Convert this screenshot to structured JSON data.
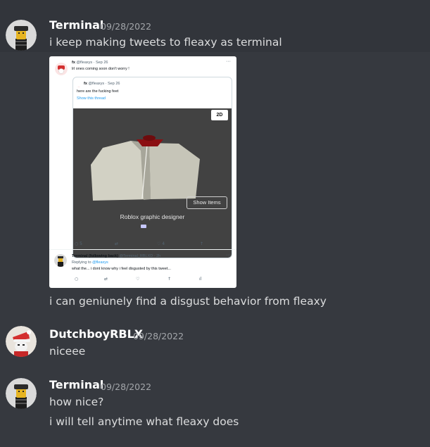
{
  "messages": [
    {
      "username": "Terminal",
      "timestamp": "09/28/2022",
      "avatar": "terminal-avatar",
      "lines": [
        "i keep making tweets to fleaxy as terminal"
      ],
      "after_attachment": "i can geniunely find a disgust behavior from fleaxy"
    },
    {
      "username": "DutchboyRBLX",
      "timestamp": "09/28/2022",
      "avatar": "dutchboy-avatar",
      "lines": [
        "niceee"
      ]
    },
    {
      "username": "Terminal",
      "timestamp": "09/28/2022",
      "avatar": "terminal-avatar",
      "lines": [
        "how nice?",
        "i will tell anytime what fleaxy does"
      ]
    }
  ],
  "attachment": {
    "tweet": {
      "name": "fx",
      "handle": "@fleaxys · Sep 26",
      "text": "lrl ones coming soon don't worry !",
      "menu": "···"
    },
    "quoted": {
      "name": "fx",
      "handle": "@fleaxys · Sep 26",
      "text": "here are the fucking feet",
      "link": "Show this thread",
      "badge": "2D",
      "show_items": "Show Items",
      "caption": "Roblox graphic designer"
    },
    "tweet_actions": {
      "replies": "5",
      "likes": "4"
    },
    "reply": {
      "name": "Terminal (following back)",
      "handle": "@Terminal_RBLXD · 2h",
      "replying_prefix": "Replying to",
      "replying_to": "@fleaxys",
      "text": "what the... i dont know why i feel disgusted by this tweet...",
      "menu": "···"
    }
  },
  "colors": {
    "background": "#36393f",
    "hover": "#32353b",
    "username": "#ffffff",
    "timestamp": "#a3a6aa",
    "text": "#dcddde",
    "twitter_link": "#1d9bf0"
  }
}
